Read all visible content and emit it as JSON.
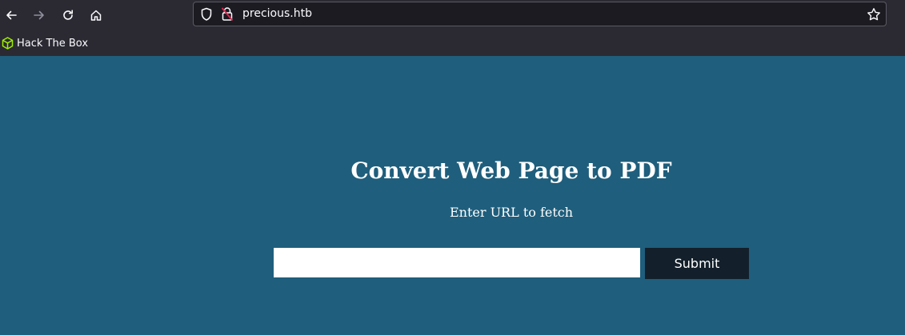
{
  "browser": {
    "url": "precious.htb",
    "bookmarks": [
      {
        "label": "Hack The Box",
        "icon": "hackthebox-cube-icon",
        "color": "#9fef00"
      }
    ]
  },
  "page": {
    "title": "Convert Web Page to PDF",
    "subtitle": "Enter URL to fetch",
    "url_input": {
      "value": "",
      "placeholder": ""
    },
    "submit_label": "Submit"
  },
  "colors": {
    "page_background": "#1f5e7c",
    "button_background": "#13202b",
    "chrome_background": "#2b2a33"
  }
}
